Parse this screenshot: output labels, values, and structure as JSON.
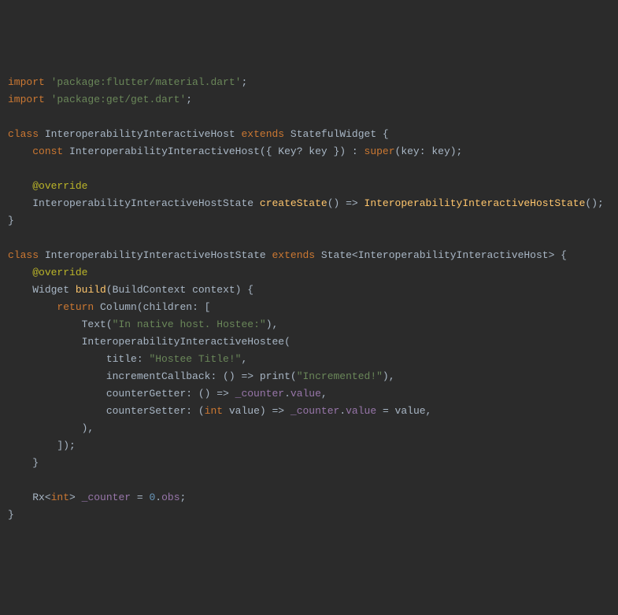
{
  "code": {
    "import_kw": "import",
    "import1_str": "'package:flutter/material.dart'",
    "import2_str": "'package:get/get.dart'",
    "class_kw": "class",
    "extends_kw": "extends",
    "const_kw": "const",
    "super_kw": "super",
    "return_kw": "return",
    "int_kw": "int",
    "class1_name": "InteroperabilityInteractiveHost",
    "class1_super": "StatefulWidget",
    "ctor_params": "({ Key? key }) : ",
    "ctor_super_args": "(key: key);",
    "override_annotation": "@override",
    "state_type": "InteroperabilityInteractiveHostState",
    "create_state_method": "createState",
    "create_state_body": "() => ",
    "state_ctor_call": "InteroperabilityInteractiveHostState",
    "state_extends": "State<InteroperabilityInteractiveHost>",
    "widget_type": "Widget",
    "build_method": "build",
    "build_params": "(BuildContext context) {",
    "column_type": "Column",
    "column_args": "(children: [",
    "text_type": "Text",
    "text_str": "\"In native host. Hostee:\"",
    "hostee_type": "InteroperabilityInteractiveHostee",
    "title_key": "title: ",
    "title_str": "\"Hostee Title!\"",
    "inc_key": "incrementCallback: () => ",
    "print_fn": "print",
    "print_str": "\"Incremented!\"",
    "getter_key": "counterGetter: () => ",
    "counter_field": "_counter",
    "value_member": "value",
    "setter_key": "counterSetter: (",
    "setter_param": " value) => ",
    "setter_assign": " = value,",
    "close_paren_comma": "),",
    "close_bracket_paren": "]);",
    "close_brace": "}",
    "rx_type": "Rx<",
    "rx_close": "> ",
    "counter_decl": "_counter",
    "eq": " = ",
    "zero": "0",
    "obs": "obs",
    "semi": ";",
    "open_brace": " {",
    "open_paren": "(",
    "close_paren": ")",
    "comma": ",",
    "dot": ".",
    "space": " "
  }
}
